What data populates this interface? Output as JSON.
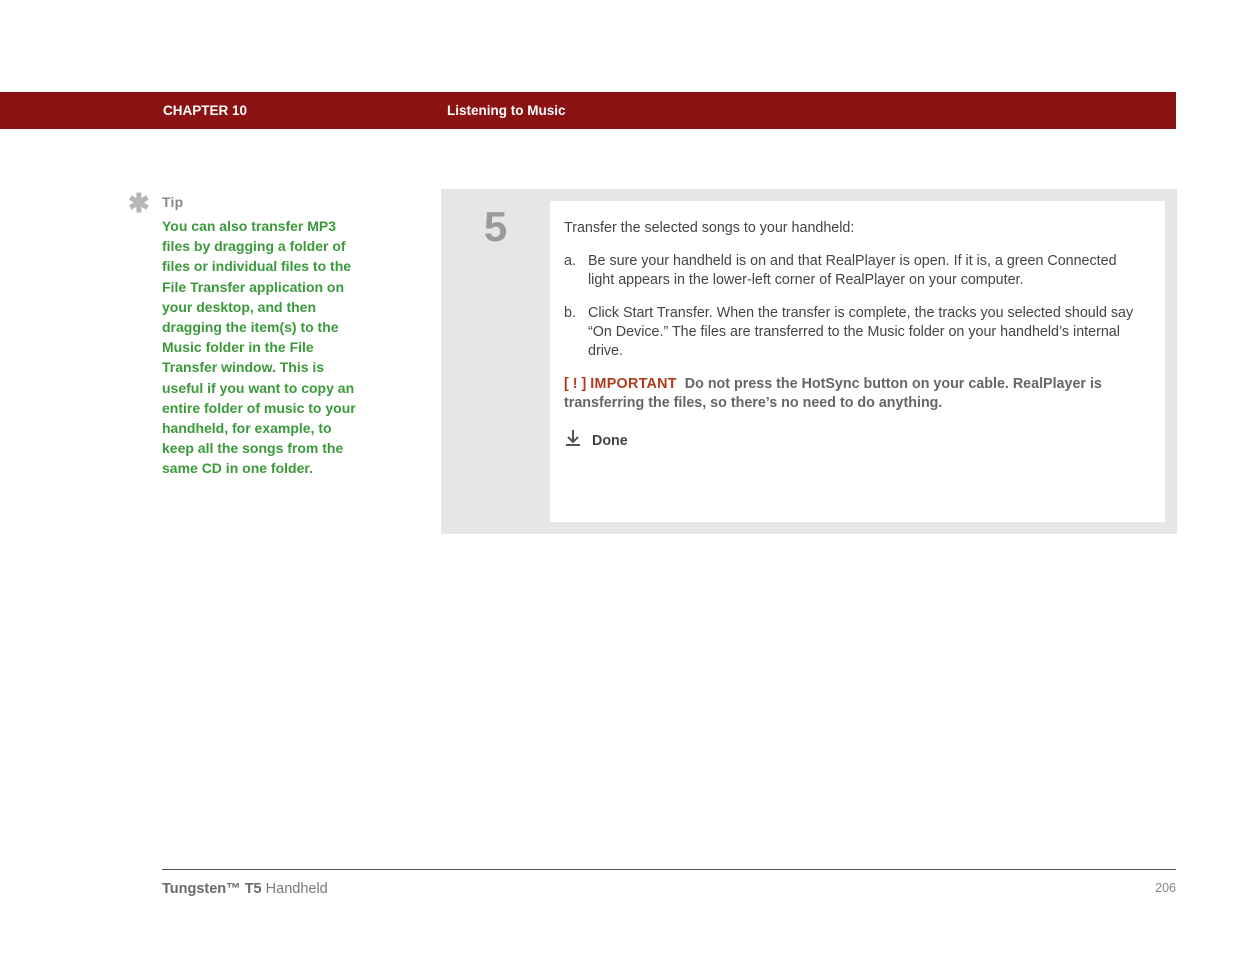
{
  "header": {
    "chapter": "CHAPTER 10",
    "title": "Listening to Music"
  },
  "sidebar": {
    "tip_label": "Tip",
    "tip_text_before_link": "You can also transfer MP3 files by dragging a folder of files or individual files to the File Transfer application on your desktop, and then dragging the item(s) to the Music folder in the ",
    "tip_link": "File Transfer window",
    "tip_text_after_link": ". This is useful if you want to copy an entire folder of music to your handheld, for example, to keep all the songs from the same CD in one folder."
  },
  "step": {
    "number": "5",
    "intro": "Transfer the selected songs to your handheld:",
    "items": [
      {
        "marker": "a.",
        "text": "Be sure your handheld is on and that RealPlayer is open. If it is, a green Connected light appears in the lower-left corner of RealPlayer on your computer."
      },
      {
        "marker": "b.",
        "text": "Click Start Transfer. When the transfer is complete, the tracks you selected should say “On Device.” The files are transferred to the Music folder on your handheld’s internal drive."
      }
    ],
    "important_prefix": "[ ! ]",
    "important_label": "IMPORTANT",
    "important_text": "Do not press the HotSync button on your cable. RealPlayer is transferring the files, so there’s no need to do anything.",
    "done": "Done"
  },
  "footer": {
    "product_bold": "Tungsten™ T5",
    "product_rest": " Handheld",
    "page": "206"
  }
}
